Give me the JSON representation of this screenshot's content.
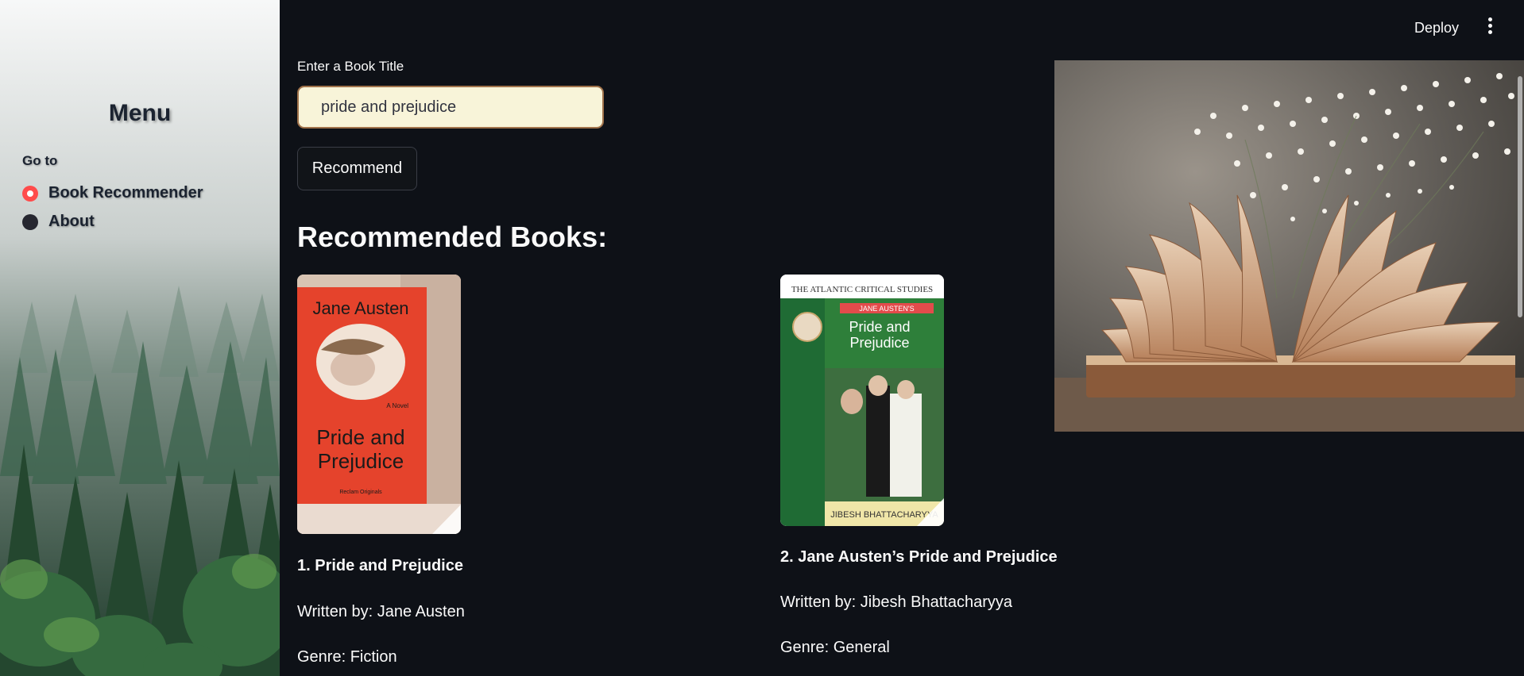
{
  "header": {
    "deploy_label": "Deploy",
    "menu_icon": "kebab-menu-icon"
  },
  "sidebar": {
    "title": "Menu",
    "radio_label": "Go to",
    "options": [
      {
        "label": "Book Recommender",
        "selected": true
      },
      {
        "label": "About",
        "selected": false
      }
    ]
  },
  "main": {
    "input_label": "Enter a Book Title",
    "input_value": "pride and prejudice",
    "button_label": "Recommend",
    "heading": "Recommended Books:",
    "books": [
      {
        "title": "1. Pride and Prejudice",
        "author": "Written by: Jane Austen",
        "genre": "Genre: Fiction",
        "cover": {
          "author_text": "Jane Austen",
          "title_line1": "Pride and",
          "title_line2": "Prejudice",
          "tag": "A Novel",
          "publisher": "Reclam Originals"
        }
      },
      {
        "title": "2. Jane Austen’s Pride and Prejudice",
        "author": "Written by: Jibesh Bhattacharyya",
        "genre": "Genre: General",
        "cover": {
          "series": "THE ATLANTIC CRITICAL STUDIES",
          "banner": "JANE AUSTEN'S",
          "title_line1": "Pride and",
          "title_line2": "Prejudice",
          "author_text": "JIBESH BHATTACHARYYA"
        }
      }
    ]
  },
  "colors": {
    "background": "#0e1117",
    "accent": "#ff4b4b",
    "input_bg": "#f8f4d9",
    "input_border": "#a0724a"
  }
}
